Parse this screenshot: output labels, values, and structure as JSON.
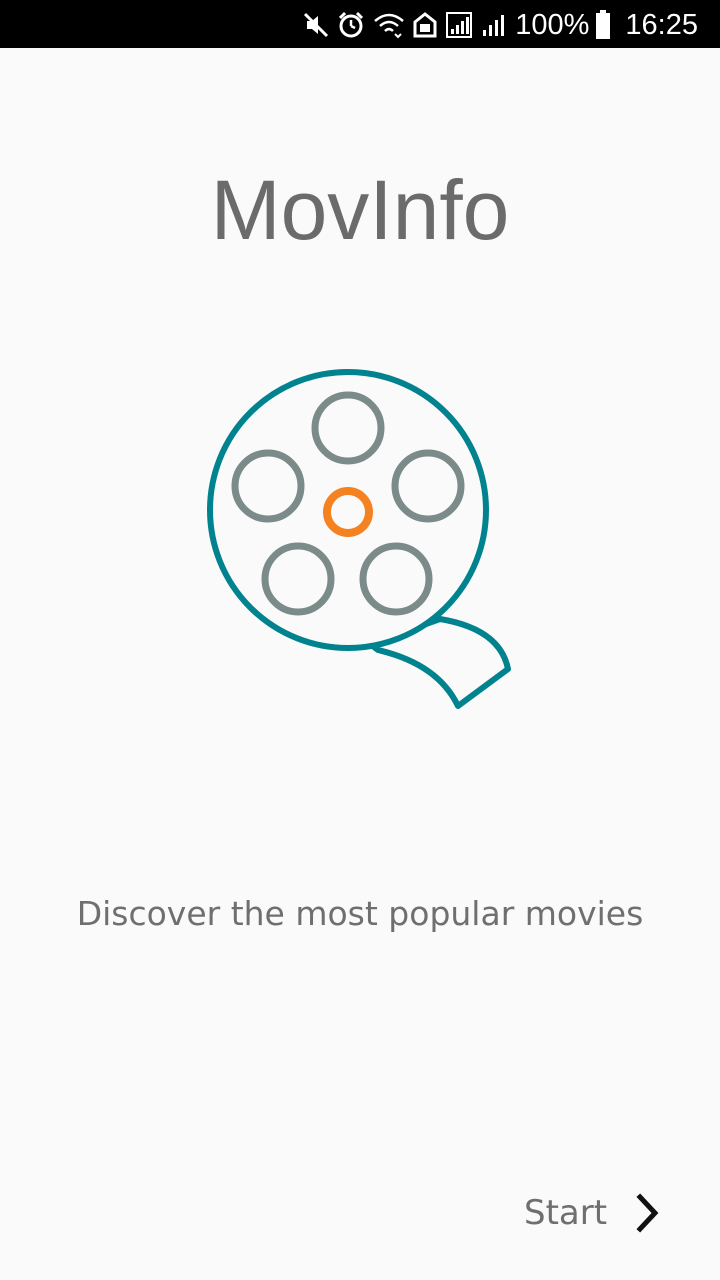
{
  "status_bar": {
    "battery": "100%",
    "time": "16:25",
    "icons": [
      "mute-icon",
      "alarm-icon",
      "wifi-icon",
      "nfc-icon",
      "signal-icon",
      "signal-bars-icon",
      "battery-icon"
    ]
  },
  "app": {
    "title": "MovInfo",
    "tagline": "Discover the most popular movies",
    "start_label": "Start"
  },
  "colors": {
    "background": "#fafafa",
    "title_text": "#6b6b6b",
    "reel_outline": "#00838f",
    "reel_holes": "#7b8b89",
    "reel_center": "#f58220"
  }
}
